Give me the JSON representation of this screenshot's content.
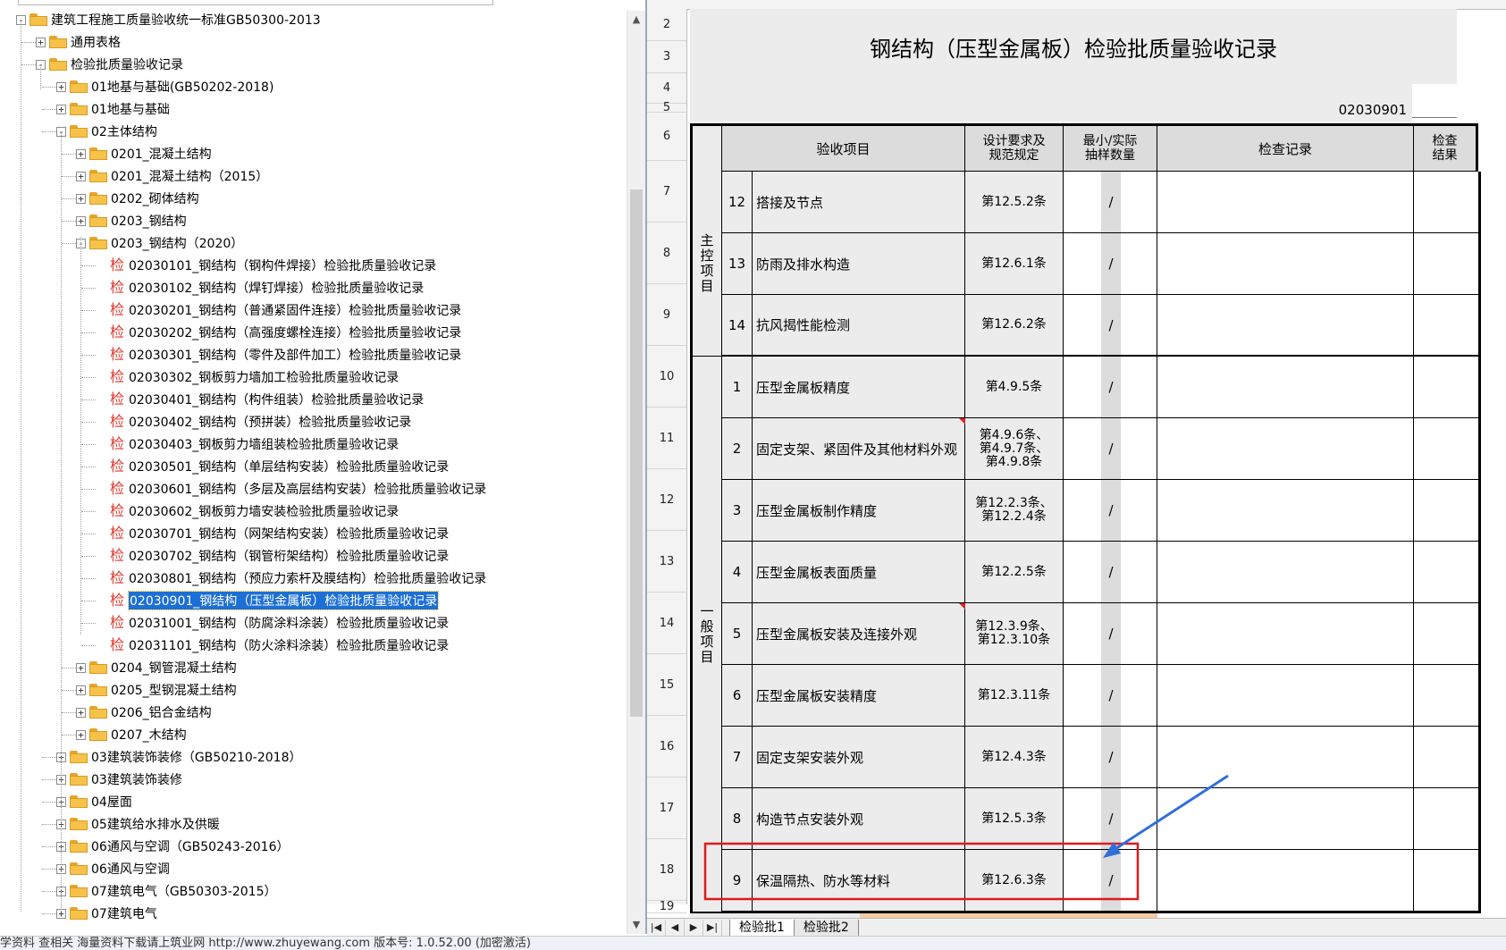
{
  "tree": {
    "root_label": "建筑工程施工质量验收统一标准GB50300-2013",
    "items": [
      {
        "level": 1,
        "label": "通用表格",
        "type": "folder",
        "expander": "+"
      },
      {
        "level": 1,
        "label": "检验批质量验收记录",
        "type": "folder",
        "expander": "-"
      },
      {
        "level": 2,
        "label": "01地基与基础(GB50202-2018)",
        "type": "folder",
        "expander": "+"
      },
      {
        "level": 2,
        "label": "01地基与基础",
        "type": "folder",
        "expander": "+"
      },
      {
        "level": 2,
        "label": "02主体结构",
        "type": "folder",
        "expander": "-"
      },
      {
        "level": 3,
        "label": "0201_混凝土结构",
        "type": "folder",
        "expander": "+"
      },
      {
        "level": 3,
        "label": "0201_混凝土结构（2015）",
        "type": "folder",
        "expander": "+"
      },
      {
        "level": 3,
        "label": "0202_砌体结构",
        "type": "folder",
        "expander": "+"
      },
      {
        "level": 3,
        "label": "0203_钢结构",
        "type": "folder",
        "expander": "+"
      },
      {
        "level": 3,
        "label": "0203_钢结构（2020）",
        "type": "folder",
        "expander": "-"
      },
      {
        "level": 4,
        "label": "02030101_钢结构（钢构件焊接）检验批质量验收记录",
        "type": "doc"
      },
      {
        "level": 4,
        "label": "02030102_钢结构（焊钉焊接）检验批质量验收记录",
        "type": "doc"
      },
      {
        "level": 4,
        "label": "02030201_钢结构（普通紧固件连接）检验批质量验收记录",
        "type": "doc"
      },
      {
        "level": 4,
        "label": "02030202_钢结构（高强度螺栓连接）检验批质量验收记录",
        "type": "doc"
      },
      {
        "level": 4,
        "label": "02030301_钢结构（零件及部件加工）检验批质量验收记录",
        "type": "doc"
      },
      {
        "level": 4,
        "label": "02030302_钢板剪力墙加工检验批质量验收记录",
        "type": "doc"
      },
      {
        "level": 4,
        "label": "02030401_钢结构（构件组装）检验批质量验收记录",
        "type": "doc"
      },
      {
        "level": 4,
        "label": "02030402_钢结构（预拼装）检验批质量验收记录",
        "type": "doc"
      },
      {
        "level": 4,
        "label": "02030403_钢板剪力墙组装检验批质量验收记录",
        "type": "doc"
      },
      {
        "level": 4,
        "label": "02030501_钢结构（单层结构安装）检验批质量验收记录",
        "type": "doc"
      },
      {
        "level": 4,
        "label": "02030601_钢结构（多层及高层结构安装）检验批质量验收记录",
        "type": "doc"
      },
      {
        "level": 4,
        "label": "02030602_钢板剪力墙安装检验批质量验收记录",
        "type": "doc"
      },
      {
        "level": 4,
        "label": "02030701_钢结构（网架结构安装）检验批质量验收记录",
        "type": "doc"
      },
      {
        "level": 4,
        "label": "02030702_钢结构（钢管桁架结构）检验批质量验收记录",
        "type": "doc"
      },
      {
        "level": 4,
        "label": "02030801_钢结构（预应力索杆及膜结构）检验批质量验收记录",
        "type": "doc"
      },
      {
        "level": 4,
        "label": "02030901_钢结构（压型金属板）检验批质量验收记录",
        "type": "doc",
        "selected": true
      },
      {
        "level": 4,
        "label": "02031001_钢结构（防腐涂料涂装）检验批质量验收记录",
        "type": "doc"
      },
      {
        "level": 4,
        "label": "02031101_钢结构（防火涂料涂装）检验批质量验收记录",
        "type": "doc"
      },
      {
        "level": 3,
        "label": "0204_钢管混凝土结构",
        "type": "folder",
        "expander": "+"
      },
      {
        "level": 3,
        "label": "0205_型钢混凝土结构",
        "type": "folder",
        "expander": "+"
      },
      {
        "level": 3,
        "label": "0206_铝合金结构",
        "type": "folder",
        "expander": "+"
      },
      {
        "level": 3,
        "label": "0207_木结构",
        "type": "folder",
        "expander": "+"
      },
      {
        "level": 2,
        "label": "03建筑装饰装修（GB50210-2018）",
        "type": "folder",
        "expander": "+"
      },
      {
        "level": 2,
        "label": "03建筑装饰装修",
        "type": "folder",
        "expander": "+"
      },
      {
        "level": 2,
        "label": "04屋面",
        "type": "folder",
        "expander": "+"
      },
      {
        "level": 2,
        "label": "05建筑给水排水及供暖",
        "type": "folder",
        "expander": "+"
      },
      {
        "level": 2,
        "label": "06通风与空调（GB50243-2016）",
        "type": "folder",
        "expander": "+"
      },
      {
        "level": 2,
        "label": "06通风与空调",
        "type": "folder",
        "expander": "+"
      },
      {
        "level": 2,
        "label": "07建筑电气（GB50303-2015）",
        "type": "folder",
        "expander": "+"
      },
      {
        "level": 2,
        "label": "07建筑电气",
        "type": "folder",
        "expander": "+"
      }
    ]
  },
  "sheet": {
    "title": "钢结构（压型金属板）检验批质量验收记录",
    "code": "02030901",
    "headers": {
      "item": "验收项目",
      "spec": "设计要求及\n规范规定",
      "sample": "最小/实际\n抽样数量",
      "record": "检查记录",
      "result": "检查\n结果"
    },
    "section_main": "主控项目",
    "section_general": "一般项目",
    "row_numbers": [
      "2",
      "3",
      "4",
      "5",
      "6",
      "7",
      "8",
      "9",
      "10",
      "11",
      "12",
      "13",
      "14",
      "15",
      "16",
      "17",
      "18",
      "19"
    ],
    "rows": [
      {
        "row": "7",
        "no": "12",
        "item": "搭接及节点",
        "spec": "第12.5.2条",
        "sample": "/"
      },
      {
        "row": "8",
        "no": "13",
        "item": "防雨及排水构造",
        "spec": "第12.6.1条",
        "sample": "/"
      },
      {
        "row": "9",
        "no": "14",
        "item": "抗风揭性能检测",
        "spec": "第12.6.2条",
        "sample": "/"
      },
      {
        "row": "10",
        "no": "1",
        "item": "压型金属板精度",
        "spec": "第4.9.5条",
        "sample": "/"
      },
      {
        "row": "11",
        "no": "2",
        "item": "固定支架、紧固件及其他材料外观",
        "spec": "第4.9.6条、\n第4.9.7条、\n第4.9.8条",
        "sample": "/"
      },
      {
        "row": "12",
        "no": "3",
        "item": "压型金属板制作精度",
        "spec": "第12.2.3条、\n第12.2.4条",
        "sample": "/"
      },
      {
        "row": "13",
        "no": "4",
        "item": "压型金属板表面质量",
        "spec": "第12.2.5条",
        "sample": "/"
      },
      {
        "row": "14",
        "no": "5",
        "item": "压型金属板安装及连接外观",
        "spec": "第12.3.9条、\n第12.3.10条",
        "sample": "/"
      },
      {
        "row": "15",
        "no": "6",
        "item": "压型金属板安装精度",
        "spec": "第12.3.11条",
        "sample": "/"
      },
      {
        "row": "16",
        "no": "7",
        "item": "固定支架安装外观",
        "spec": "第12.4.3条",
        "sample": "/"
      },
      {
        "row": "17",
        "no": "8",
        "item": "构造节点安装外观",
        "spec": "第12.5.3条",
        "sample": "/"
      },
      {
        "row": "18",
        "no": "9",
        "item": "保温隔热、防水等材料",
        "spec": "第12.6.3条",
        "sample": "/"
      }
    ]
  },
  "tabs": [
    "检验批1",
    "检验批2"
  ],
  "nav_buttons": [
    "|◀",
    "◀",
    "▶",
    "▶|"
  ],
  "status_bar": "学资料   查相关   海量资料下载请上筑业网   http://www.zhuyewang.com   版本号: 1.0.52.00 (加密激活)",
  "colors": {
    "selection": "#1c6fd6",
    "highlight_box": "#e0191b",
    "arrow": "#2f6fd8",
    "header_gray": "#dcdcdc",
    "sheet_bottom_fill": "#f7cba5"
  }
}
